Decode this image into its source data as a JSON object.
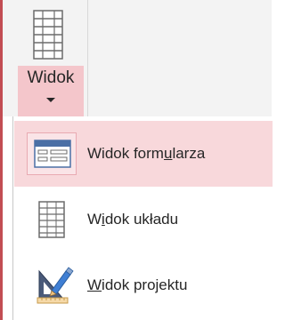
{
  "ribbon": {
    "view_button": {
      "label": "Widok",
      "icon": "datasheet-view-icon"
    }
  },
  "menu": {
    "items": [
      {
        "label_before": "Widok form",
        "label_underline": "u",
        "label_after": "larza",
        "icon": "form-view-icon",
        "highlighted": true
      },
      {
        "label_before": "W",
        "label_underline": "i",
        "label_after": "dok układu",
        "icon": "layout-view-icon",
        "highlighted": false
      },
      {
        "label_before": "",
        "label_underline": "W",
        "label_after": "idok projektu",
        "icon": "design-view-icon",
        "highlighted": false
      }
    ]
  },
  "colors": {
    "accent": "#c24d53",
    "highlight": "#f8d8db",
    "dropdown_pressed": "#f4c6cb"
  }
}
